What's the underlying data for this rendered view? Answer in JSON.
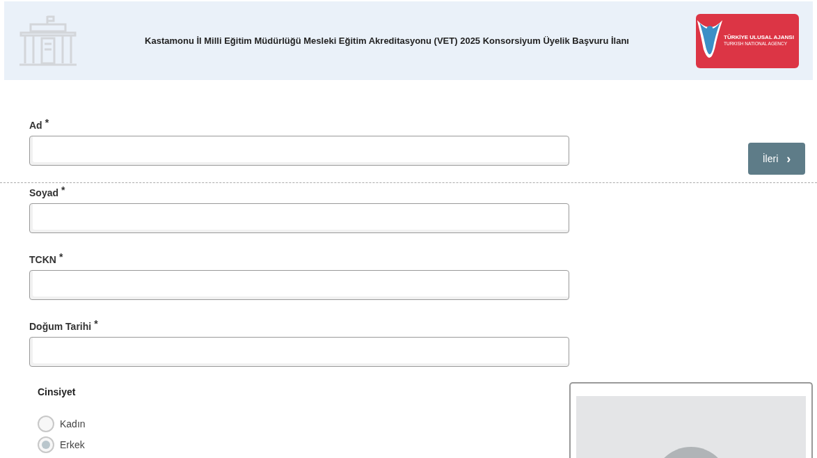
{
  "header": {
    "title": "Kastamonu İl Milli Eğitim Müdürlüğü Mesleki Eğitim Akreditasyonu (VET) 2025 Konsorsiyum Üyelik Başvuru İlanı",
    "logo": {
      "name": "TÜRKİYE ULUSAL AJANSI",
      "subtitle": "TURKISH NATIONAL AGENCY"
    }
  },
  "fields": [
    {
      "label": "Ad",
      "required_mark": "*"
    },
    {
      "label": "Soyad",
      "required_mark": "*"
    },
    {
      "label": "TCKN",
      "required_mark": "*"
    },
    {
      "label": "Doğum Tarihi",
      "required_mark": "*"
    }
  ],
  "next_button": {
    "label": "İleri",
    "icon": "›"
  },
  "gender": {
    "label": "Cinsiyet",
    "options": [
      {
        "label": "Kadın",
        "selected": false
      },
      {
        "label": "Erkek",
        "selected": true
      }
    ]
  },
  "photo": {
    "kind": "placeholder"
  }
}
